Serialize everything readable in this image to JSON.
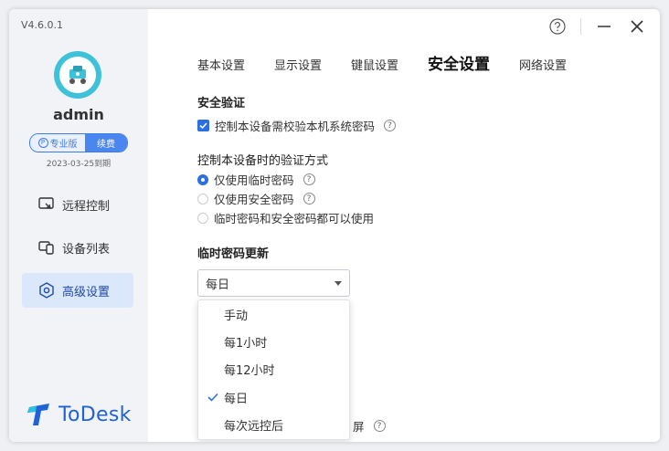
{
  "version": "V4.6.0.1",
  "user": {
    "name": "admin",
    "plan": "专业版",
    "renew": "续费",
    "expire": "2023-03-25到期"
  },
  "nav": [
    {
      "label": "远程控制",
      "icon": "remote-control-icon"
    },
    {
      "label": "设备列表",
      "icon": "device-list-icon"
    },
    {
      "label": "高级设置",
      "icon": "advanced-settings-icon"
    }
  ],
  "brand": {
    "name": "ToDesk"
  },
  "tabs": [
    "基本设置",
    "显示设置",
    "键鼠设置",
    "安全设置",
    "网络设置"
  ],
  "security": {
    "verify_title": "安全验证",
    "verify_checkbox": "控制本设备需校验本机系统密码",
    "method_title": "控制本设备时的验证方式",
    "methods": [
      "仅使用临时密码",
      "仅使用安全密码",
      "临时密码和安全密码都可以使用"
    ],
    "method_selected": "仅使用临时密码",
    "temp_update_title": "临时密码更新",
    "temp_update_value": "每日",
    "temp_update_options": [
      "手动",
      "每1小时",
      "每12小时",
      "每日",
      "每次远控后"
    ],
    "partially_hidden_text": "屏"
  },
  "colors": {
    "accent": "#2b6fe3",
    "brand": "#1f63d6",
    "sidebar_bg": "#f1f3f6",
    "active_nav_bg": "#dbe7fb"
  }
}
